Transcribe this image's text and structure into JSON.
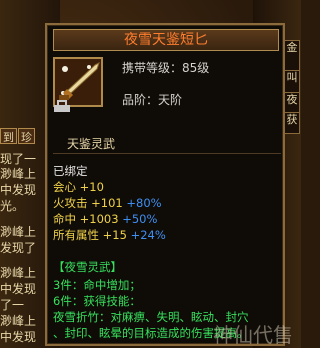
{
  "item": {
    "name": "夜雪天鉴短匕",
    "level_label": "携带等级：",
    "level_value": "85级",
    "grade_label": "品阶：",
    "grade_value": "天阶",
    "set_title": "天鉴灵武",
    "bound": "已绑定",
    "stats": [
      {
        "label": "会心",
        "base": "+10",
        "bonus": ""
      },
      {
        "label": "火攻击",
        "base": "+101",
        "bonus": "+80%"
      },
      {
        "label": "命中",
        "base": "+1003",
        "bonus": "+50%"
      },
      {
        "label": "所有属性",
        "base": "+15",
        "bonus": "+24%"
      }
    ],
    "set": {
      "header": "【夜雪灵武】",
      "piece3_prefix": "3件：",
      "piece3_text": "命中增加；",
      "piece6_prefix": "6件：",
      "piece6_text": "获得技能：",
      "skill_line1": "夜雪折竹：对麻痹、失明、眩动、封穴",
      "skill_line2": "、封印、眩晕的目标造成的伤害提高。"
    }
  },
  "background": {
    "left_lines": [
      "现了一",
      "渺峰上",
      "中发现",
      "光。",
      "渺峰上",
      "发现了",
      "渺峰上",
      "中发现",
      "了一",
      "渺峰上",
      "中发现"
    ],
    "left_tabs": [
      "到",
      "珍"
    ],
    "right_tabs": [
      "金",
      "叫",
      "夜",
      "获"
    ]
  },
  "watermark": "神仙代售",
  "colors": {
    "title": "#ff7d2e",
    "green": "#37e15d",
    "yellow": "#f0d24a",
    "blue": "#3e8ff2"
  }
}
